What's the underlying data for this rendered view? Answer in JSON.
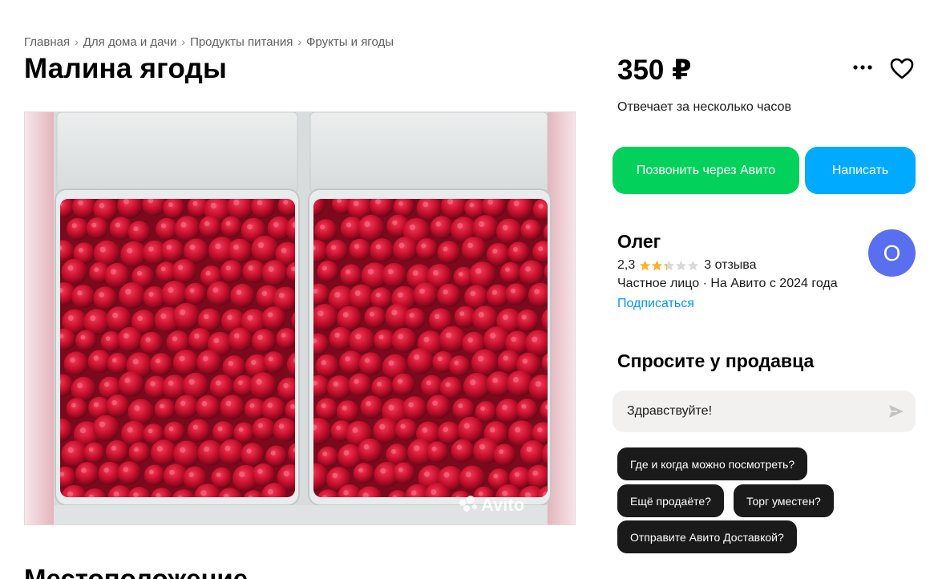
{
  "breadcrumbs": [
    "Главная",
    "Для дома и дачи",
    "Продукты питания",
    "Фрукты и ягоды"
  ],
  "breadcrumb_separator": "›",
  "listing": {
    "title": "Малина ягоды",
    "price": "350 ₽",
    "photo_watermark": "Avito"
  },
  "seller_panel": {
    "reply_time": "Отвечает за несколько часов",
    "call_button": "Позвонить через Авито",
    "write_button": "Написать"
  },
  "seller": {
    "name": "Олег",
    "rating": "2,3",
    "rating_stars": 2.3,
    "reviews": "3 отзыва",
    "info": "Частное лицо · На Авито с 2024 года",
    "subscribe": "Подписаться",
    "avatar_letter": "О"
  },
  "ask": {
    "title": "Спросите у продавца",
    "message_value": "Здравствуйте!",
    "quick_questions": [
      "Где и когда можно посмотреть?",
      "Ещё продаёте?",
      "Торг уместен?",
      "Отправите Авито Доставкой?"
    ]
  },
  "next_section_title": "Местоположение",
  "colors": {
    "call_button": "#02d15c",
    "write_button": "#00aaff",
    "link": "#0099f7",
    "avatar": "#5a6ef0",
    "chip": "#1a1a1a",
    "star_filled": "#ffb021",
    "star_empty": "#d9d9d9"
  },
  "icons": {
    "more": "more-dots-icon",
    "favorite": "heart-icon",
    "send": "send-icon",
    "star": "star-icon"
  }
}
